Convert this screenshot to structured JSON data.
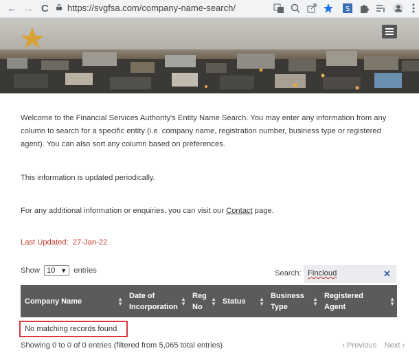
{
  "browser": {
    "url": "https://svgfsa.com/company-name-search/",
    "back_glyph": "←",
    "forward_glyph": "→",
    "reload_glyph": "C",
    "toolbar_icons": [
      "translate-icon",
      "zoom-icon",
      "share-icon",
      "star-icon",
      "extension-s-icon",
      "puzzle-icon",
      "reading-list-icon",
      "profile-icon",
      "kebab-menu-icon"
    ]
  },
  "intro": {
    "paragraph": "Welcome to the Financial Services Authority's Entity Name Search. You may enter any information from any column to search for a specific entity (i.e. company name, registration number, business type or registered agent). You can also sort any column based on preferences.",
    "periodic": "This information is updated periodically.",
    "enquiries_prefix": "For any additional information or enquiries, you can visit our ",
    "enquiries_link": "Contact",
    "enquiries_suffix": " page."
  },
  "last_updated": {
    "label": "Last Updated:",
    "value": "27-Jan-22"
  },
  "table_controls": {
    "show_label": "Show",
    "show_value": "10",
    "entries_label": "entries",
    "search_label": "Search:",
    "search_value": "Fincloud"
  },
  "table": {
    "columns": [
      {
        "line1": "Company Name",
        "line2": ""
      },
      {
        "line1": "Date of",
        "line2": "Incorporation"
      },
      {
        "line1": "Reg",
        "line2": "No"
      },
      {
        "line1": "Status",
        "line2": ""
      },
      {
        "line1": "Business",
        "line2": "Type"
      },
      {
        "line1": "Registered",
        "line2": "Agent"
      }
    ],
    "empty_message": "No matching records found",
    "info": "Showing 0 to 0 of 0 entries (filtered from 5,065 total entries)",
    "prev": "‹ Previous",
    "next": "Next ›"
  },
  "colors": {
    "header_bg": "#5b5b5b",
    "last_updated": "#c0392b",
    "highlight_border": "#d9363e"
  }
}
